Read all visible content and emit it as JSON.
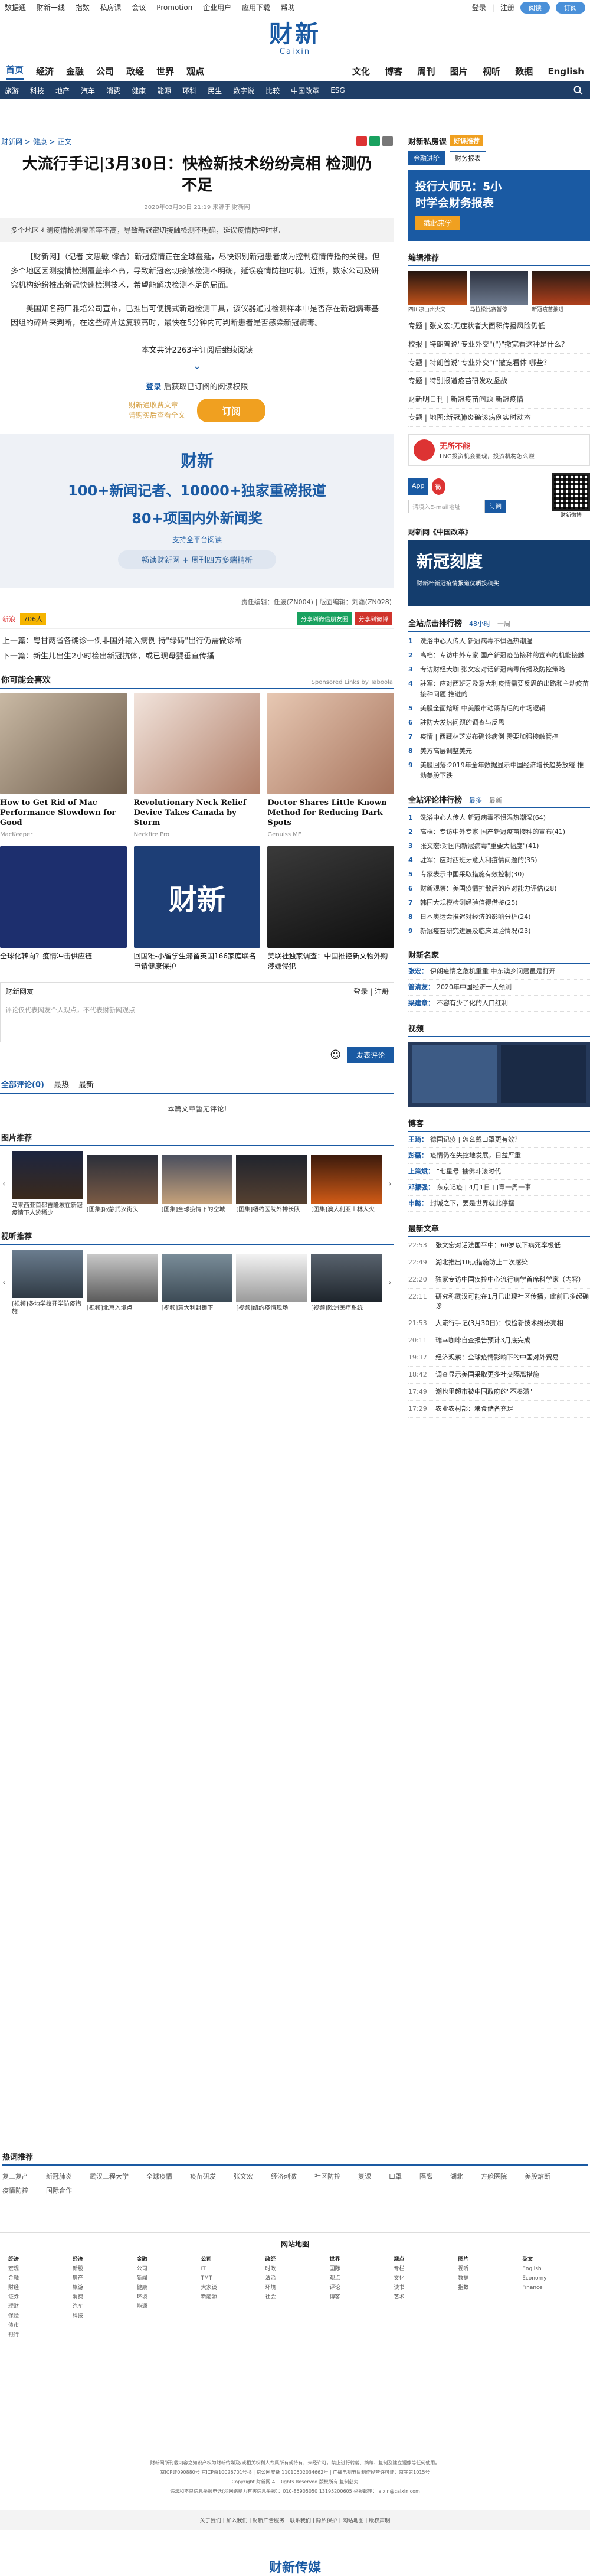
{
  "topbar": {
    "links": [
      "数据通",
      "财新一线",
      "指数",
      "私房课",
      "会议",
      "Promotion",
      "企业用户",
      "应用下载",
      "帮助"
    ],
    "login": "登录",
    "register": "注册",
    "pill1": "阅读",
    "pill2": "订阅"
  },
  "logo": {
    "zh": "财新",
    "en": "Caixin"
  },
  "nav1": {
    "left": [
      "首页",
      "经济",
      "金融",
      "公司",
      "政经",
      "世界",
      "观点"
    ],
    "right": [
      "文化",
      "博客",
      "周刊",
      "图片",
      "视听",
      "数据",
      "English"
    ]
  },
  "nav2": [
    "旅游",
    "科技",
    "地产",
    "汽车",
    "消费",
    "健康",
    "能源",
    "环科",
    "民生",
    "数字说",
    "比较",
    "中国改革",
    "ESG"
  ],
  "article": {
    "crumb": "财新网 > 健康 > 正文",
    "title": "大流行手记|3月30日：快检新技术纷纷亮相 检测仍不足",
    "meta": "2020年03月30日 21:19  来源于  财新网",
    "summary": "多个地区团测疫情检测覆盖率不高，导致新冠密切接触检测不明确，延误疫情防控时机",
    "p1": "【财新网】（记者 文思敏 综合）新冠疫情正在全球蔓延，尽快识别新冠患者成为控制疫情传播的关键。但多个地区因测疫情检测覆盖率不高，导致新冠密切接触检测不明确，延误疫情防控时机。近期，数家公司及研究机构纷纷推出新冠快速检测技术，希望能解决检测不足的局面。",
    "p2": "美国知名药厂雅培公司宣布，已推出可便携式新冠检测工具，该仪器通过检测样本中是否存在新冠病毒基因组的碎片来判断，在这些碎片送复较高时，最快在5分钟内可判断患者是否感染新冠病毒。",
    "count": "本文共计2263字订阅后继续阅读",
    "login_prefix": "登录",
    "login_suffix": " 后获取已订阅的阅读权限",
    "sub_left1": "财新通收费文章",
    "sub_left2": "请购买后查看全文",
    "subscribe": "订阅",
    "editor": "责任编辑：任波(ZN004) | 版面编辑：刘潇(ZN028)",
    "weibo": "新浪",
    "share_count": "706人",
    "tag1": "分享到微信朋友圈",
    "tag2": "分享到微博",
    "prev": "上一篇：粤甘两省各确诊一例非国外输入病例 持\"绿码\"出行仍需做诊断",
    "next": "下一篇：新生儿出生2小时检出新冠抗体，或已现母婴垂直传播"
  },
  "promo": {
    "brand": "财新",
    "line1": "100+新闻记者、10000+独家重磅报道",
    "line2": "80+项国内外新闻奖",
    "small": "支持全平台阅读",
    "btn": "畅读财新网 + 周刊四方多端精析",
    "hint": ""
  },
  "recommend": {
    "title": "你可能会喜欢",
    "sponsored": "Sponsored Links by Taboola",
    "cards": [
      {
        "cap": "How to Get Rid of Mac Performance Slowdown for Good",
        "src": "MacKeeper"
      },
      {
        "cap": "Revolutionary Neck Relief Device Takes Canada by Storm",
        "src": "Neckfire Pro"
      },
      {
        "cap": "Doctor Shares Little Known Method for Reducing Dark Spots",
        "src": "Genuiss ME"
      },
      {
        "cap": "全球化转向？疫情冲击供应链",
        "src": ""
      },
      {
        "cap": "回国难-小留学生滞留英国166家庭联名申请健康保护",
        "src": ""
      },
      {
        "cap": "美联社独家调查：中国推控新文物外购涉嫌侵犯",
        "src": ""
      }
    ]
  },
  "comment": {
    "head_left": "财新网友",
    "head_right": "登录 | 注册",
    "placeholder": "评论仅代表网友个人观点，不代表财新网观点",
    "submit": "发表评论",
    "tab1": "全部评论(0)",
    "tab2": "最热",
    "tab3": "最新",
    "empty": "本篇文章暂无评论!"
  },
  "picture": {
    "title": "图片推荐",
    "items": [
      "马来西亚首都吉隆坡在新冠疫情下人迹稀少",
      "[图集]寂静武汉街头",
      "[图集]全球疫情下的空城",
      "[图集]纽约医院外排长队",
      "[图集]澳大利亚山林大火"
    ]
  },
  "video": {
    "title": "视听推荐",
    "items": [
      "[视频]多地学校开学防疫措施",
      "[视频]北京入境点",
      "[视频]意大利封锁下",
      "[视频]纽约疫情现场",
      "[视频]欧洲医疗系统"
    ]
  },
  "sidebar": {
    "class_title": "财新私房课",
    "class_tag": "好课推荐",
    "tabs": [
      "金融进阶",
      "财务报表"
    ],
    "ad_line1": "投行大师兄：5小",
    "ad_line2": "时学会财务报表",
    "ad_btn": "戳此来学",
    "editor_title": "编辑推荐",
    "editor_thumbs": [
      "四川凉山州火灾",
      "马拉松比赛暂停",
      "新冠疫苗推进"
    ],
    "editor_list": [
      "专题 | 张文宏:无症状者大面积传播风险仍低",
      "校报 | 特朗普说\"专业外交\"(\")\"撤宽看这种是什么？",
      "专题 | 特朗普说\"专业外交\"(\"撤宽看体 哪些？",
      "专题 | 特别报道疫苗研发攻坚战",
      "财新明日刊 | 新冠疫苗问题 新冠疫情",
      "专题 | 地图:新冠肺炎确诊病例实时动态"
    ],
    "promo2_line": "无所不能",
    "promo2_sub": "LNG投资机会显现，投资机构怎么赚",
    "app_label": "App",
    "email_placeholder": "请填入E-mail地址",
    "email_btn": "订阅",
    "qr_label": "财新微博",
    "reform_title": "财新网《中国改革》",
    "reform_line1": "新冠刻度",
    "reform_line2": "财新杯新冠疫情报道优质投稿奖",
    "rank1_title": "全站点击排行榜",
    "rank1_sub1": "48小时",
    "rank1_sub2": "一周",
    "rank1": [
      "洗浴中心人传人 新冠病毒不惧温热潮湿",
      "高档：专访中外专家 国产新冠疫苗接种的宣布的机能接触",
      "专访财经大咖 张文宏对话新冠病毒传播及防控策略",
      "驻军：应对西班牙及意大利疫情需要反思的出路和主动疫苗接种问题 推进的",
      "美股全面熔断 中美股市动荡背后的市场逻辑",
      "驻防大发热问题的调查与反思",
      "疫情 | 西藏林芝发布确诊病例 需要加强接触管控",
      "美方高层调整美元",
      "美股回落:2019年全年数据显示中国经济增长趋势放缓 推动美股下跌"
    ],
    "rank2_title": "全站评论排行榜",
    "rank2_sub1": "最多",
    "rank2_sub2": "最新",
    "rank2": [
      "洗浴中心人传人 新冠病毒不惧温热潮湿(64)",
      "高档：专访中外专家 国产新冠疫苗接种的宣布(41)",
      "张文宏:对国内新冠病毒\"重要大幅度\"(41)",
      "驻军：应对西班牙意大利疫情问题的(35)",
      "专家表示中国采取措施有效控制(30)",
      "财新观察：美国疫情扩散后的应对能力评估(28)",
      "韩国大规模检测经验值得借鉴(25)",
      "日本奥运会推迟对经济的影响分析(24)",
      "新冠疫苗研究进展及临床试验情况(23)"
    ],
    "blog_title": "财新名家",
    "blog": [
      {
        "k": "张宏：",
        "t": "伊朗疫情之危机重重 中东澳乡问题虽是打开"
      },
      {
        "k": "管清友：",
        "t": "2020年中国经济十大预测"
      },
      {
        "k": "梁建章：",
        "t": "不容有少子化的人口红利"
      }
    ],
    "video_title": "视频",
    "blogs_title": "博客",
    "blogs": [
      {
        "k": "王琦：",
        "t": "德国记疫 | 怎么戴口罩更有效？"
      },
      {
        "k": "彭磊：",
        "t": "疫情仍在失控地发展，日益严重"
      },
      {
        "k": "上策斌：",
        "t": "\"七星号\"抽佛斗法时代"
      },
      {
        "k": "邓振强：",
        "t": "东京记疫 | 4月1日 口罩一周一事"
      },
      {
        "k": "申懿：",
        "t": "封城之下，要是世界就此停摆"
      }
    ],
    "latest_title": "最新文章",
    "latest": [
      {
        "tm": "22:53",
        "t": "张文宏对话法国平中：60岁以下病死率极低"
      },
      {
        "tm": "22:49",
        "t": "湖北推出10点措施防止二次感染"
      },
      {
        "tm": "22:20",
        "t": "独家专访中国疾控中心流行病学首席科学家（内容）"
      },
      {
        "tm": "22:11",
        "t": "研究称武汉可能在1月已出现社区传播，此前已多起确诊"
      },
      {
        "tm": "21:53",
        "t": "大流行手记(3月30日)：快检新技术纷纷亮相"
      },
      {
        "tm": "20:11",
        "t": "瑞幸咖啡自查报告预计3月底完成"
      },
      {
        "tm": "19:37",
        "t": "经济观察：全球疫情影响下的中国对外贸易"
      },
      {
        "tm": "18:42",
        "t": "调查显示美国采取更多社交隔离措施"
      },
      {
        "tm": "17:49",
        "t": "潮也里超市被中国政府的\"不凑满\""
      },
      {
        "tm": "17:29",
        "t": "农业农村部：粮食储备充足"
      }
    ]
  },
  "hot": {
    "title": "热词推荐",
    "words": [
      "复工复产",
      "新冠肺炎",
      "武汉工程大学",
      "全球疫情",
      "疫苗研发",
      "张文宏",
      "经济刺激",
      "社区防控",
      "复课",
      "口罩",
      "隔离",
      "湖北",
      "方舱医院",
      "美股熔断",
      "疫情防控",
      "国际合作"
    ]
  },
  "sitemap": {
    "title": "网站地图",
    "cols": [
      [
        "经济",
        "宏观",
        "金融",
        "财经",
        "证券",
        "理财",
        "保险",
        "债市",
        "银行"
      ],
      [
        "经济",
        "新股",
        "房产",
        "旅游",
        "消费",
        "汽车",
        "科技"
      ],
      [
        "金融",
        "公司",
        "新闻",
        "健康",
        "环境",
        "能源"
      ],
      [
        "公司",
        "IT",
        "TMT",
        "大家谈",
        "新能源"
      ],
      [
        "政经",
        "时政",
        "法治",
        "环境",
        "社会"
      ],
      [
        "世界",
        "国际",
        "观点",
        "评论",
        "博客"
      ],
      [
        "观点",
        "专栏",
        "文化",
        "读书",
        "艺术"
      ],
      [
        "图片",
        "视听",
        "数据",
        "指数"
      ],
      [
        "英文",
        "English",
        "Economy",
        "Finance"
      ]
    ]
  },
  "copyright": {
    "l1": "财新网所刊载内容之知识产权为财新传媒及/或相关权利人专属所有或持有，未经许可，禁止进行转载、摘编、复制及建立镜像等任何使用。",
    "l2": "京ICP证090880号 京ICP备10026701号-8 | 京公网安备 11010502034662号 | 广播电视节目制作经营许可证：京字第1015号",
    "l3": "Copyright 财新网 All Rights Reserved 版权所有 复制必究",
    "l4": "违法和不良信息举报电话(涉网络暴力有害信息举报）：010-85905050 13195200605  举报邮箱：laixin@caixin.com"
  },
  "bottom": {
    "line": "关于我们 | 加入我们 | 财新广告服务 | 联系我们 | 隐私保护 | 网站地图 | 版权声明",
    "brand": "财新传媒"
  },
  "colors": {
    "accent": "#1a5aa3",
    "nav_dark": "#1f3e66",
    "subscribe": "#f0a020"
  }
}
